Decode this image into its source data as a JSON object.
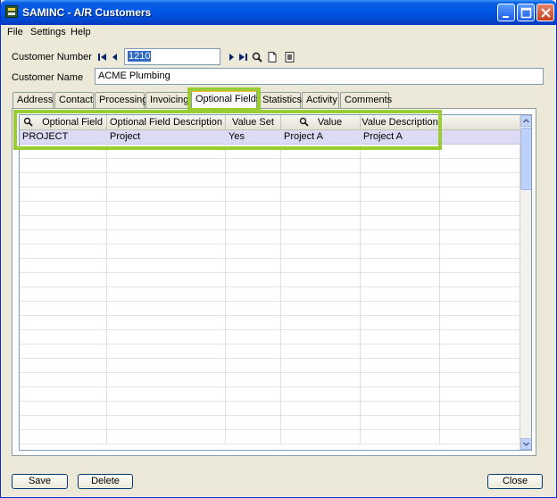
{
  "window": {
    "title": "SAMINC - A/R Customers",
    "controls": [
      "minimize",
      "maximize",
      "close"
    ]
  },
  "menu": [
    "File",
    "Settings",
    "Help"
  ],
  "form": {
    "customer_number_label": "Customer Number",
    "customer_number_value": "1210",
    "customer_name_label": "Customer Name",
    "customer_name_value": "ACME Plumbing"
  },
  "tabs": [
    "Address",
    "Contact",
    "Processing",
    "Invoicing",
    "Optional Fields",
    "Statistics",
    "Activity",
    "Comments"
  ],
  "active_tab": "Optional Fields",
  "grid": {
    "columns": [
      "Optional Field",
      "Optional Field Description",
      "Value Set",
      "Value",
      "Value Description"
    ],
    "rows": [
      [
        "PROJECT",
        "Project",
        "Yes",
        "Project A",
        "Project A"
      ]
    ]
  },
  "buttons": {
    "save": "Save",
    "delete": "Delete",
    "close": "Close"
  },
  "colors": {
    "highlight": "#9acd32",
    "selected_row": "#dcdaf4",
    "title_bar": "#0058e6"
  }
}
